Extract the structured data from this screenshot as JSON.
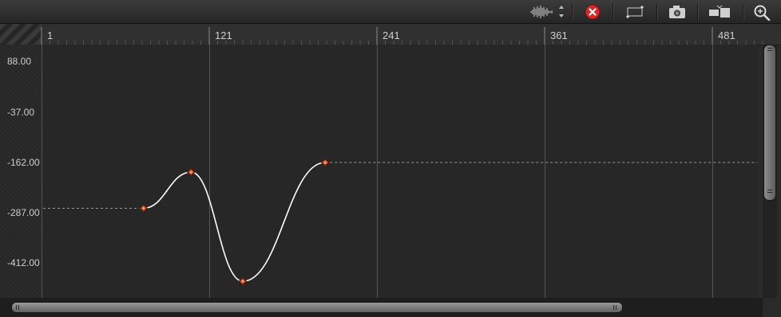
{
  "toolbar": {
    "buttons": [
      {
        "id": "audio-waveform",
        "icon": "waveform-icon"
      },
      {
        "id": "delete-curve",
        "icon": "close-circle-icon"
      },
      {
        "id": "edit-keyframe",
        "icon": "keyframe-tool-icon"
      },
      {
        "id": "snapshot",
        "icon": "camera-icon"
      },
      {
        "id": "fit",
        "icon": "fit-range-icon"
      },
      {
        "id": "zoom",
        "icon": "zoom-icon"
      }
    ]
  },
  "ruler": {
    "frame_labels": [
      "1",
      "121",
      "241",
      "361",
      "481"
    ]
  },
  "value_axis": {
    "labels": [
      "88.00",
      "-37.00",
      "-162.00",
      "-287.00",
      "-412.00"
    ]
  },
  "curve": {
    "keyframes": [
      {
        "frame": 74,
        "value": -276
      },
      {
        "frame": 108,
        "value": -186
      },
      {
        "frame": 145,
        "value": -458
      },
      {
        "frame": 204,
        "value": -162
      }
    ],
    "colors": {
      "curve": "#ffffff",
      "keyframe_fill": "#c9502a",
      "keyframe_stroke": "#5a1a0a",
      "extrapolation": "#9a9a9a",
      "grid": "#3f3f3f"
    }
  }
}
